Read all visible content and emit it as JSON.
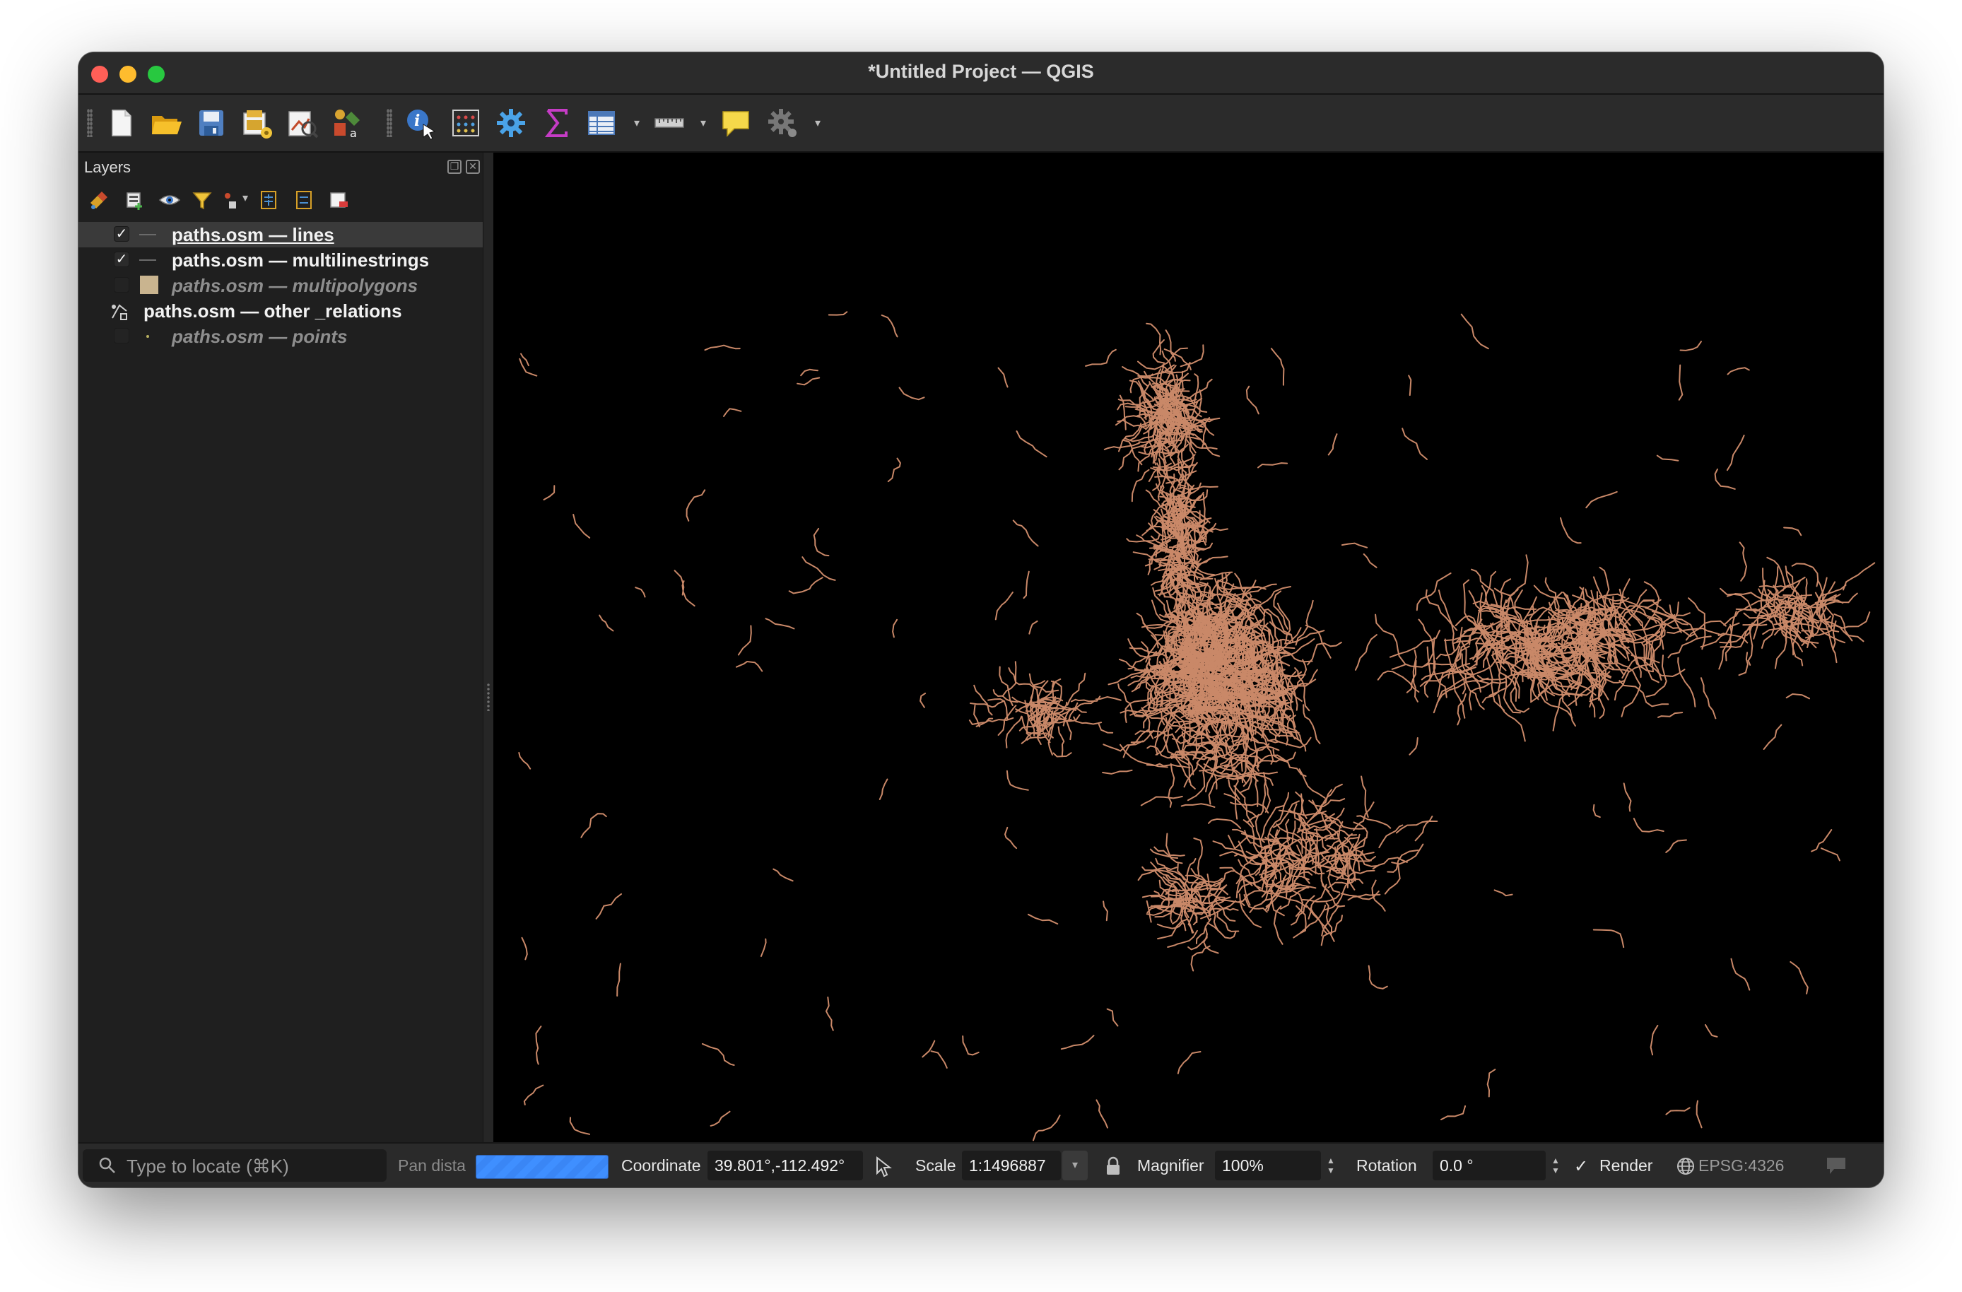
{
  "window": {
    "title": "*Untitled Project — QGIS"
  },
  "toolbar": {
    "icons": [
      "new-project-icon",
      "open-project-icon",
      "save-project-icon",
      "print-layout-icon",
      "style-manager-icon",
      "open-source-manager-icon",
      "identify-features-icon",
      "attribute-table-icon",
      "settings-icon",
      "statistics-sum-icon",
      "open-table-icon",
      "measure-icon",
      "map-tips-icon",
      "processing-toolbox-icon"
    ]
  },
  "layers_panel": {
    "title": "Layers",
    "layers": [
      {
        "name": "paths.osm — lines",
        "checked": true,
        "visible_style": "active",
        "selected": true,
        "symbol": "line"
      },
      {
        "name": "paths.osm — multilinestrings",
        "checked": true,
        "visible_style": "active",
        "selected": false,
        "symbol": "line"
      },
      {
        "name": "paths.osm — multipolygons",
        "checked": false,
        "visible_style": "disabled",
        "selected": false,
        "symbol": "fill"
      },
      {
        "name": "paths.osm — other _relations",
        "checked": null,
        "visible_style": "active",
        "selected": false,
        "symbol": "geometry-collection"
      },
      {
        "name": "paths.osm — points",
        "checked": false,
        "visible_style": "disabled",
        "selected": false,
        "symbol": "point"
      }
    ]
  },
  "statusbar": {
    "locator_placeholder": "Type to locate (⌘K)",
    "pan_label": "Pan dista",
    "coordinate_label": "Coordinate",
    "coordinate_value": "39.801°,-112.492°",
    "scale_label": "Scale",
    "scale_value": "1:1496887",
    "magnifier_label": "Magnifier",
    "magnifier_value": "100%",
    "rotation_label": "Rotation",
    "rotation_value": "0.0 °",
    "render_label": "Render",
    "render_checked": true,
    "crs_label": "EPSG:4326"
  },
  "map": {
    "background": "#000000",
    "feature_color": "#c98868"
  },
  "colors": {
    "window_bg": "#1e1e1e",
    "toolbar_bg": "#2b2b2b",
    "progress_blue": "#3f8fff"
  }
}
